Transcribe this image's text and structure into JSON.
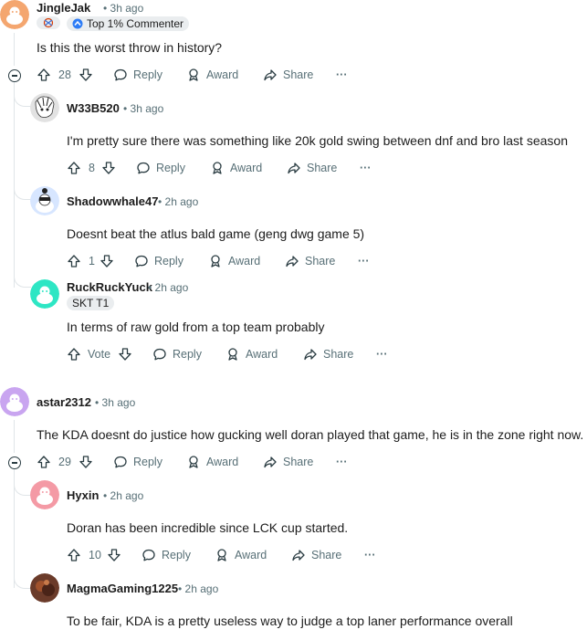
{
  "comments": [
    {
      "user": "JingleJak",
      "time": "3h ago",
      "badge": "Top 1% Commenter",
      "text": "Is this the worst throw in history?",
      "votes": "28",
      "reply": "Reply",
      "award": "Award",
      "share": "Share",
      "more": "···",
      "avatar_color": "#f4a66f"
    },
    {
      "user": "W33B520",
      "time": "3h ago",
      "text": "I'm pretty sure there was something like 20k gold swing between dnf and bro last season",
      "votes": "8",
      "reply": "Reply",
      "award": "Award",
      "share": "Share",
      "more": "···",
      "avatar_color": "#d9d9d9"
    },
    {
      "user": "Shadowwhale47",
      "time": "2h ago",
      "text": "Doesnt beat the atlus bald game (geng dwg game 5)",
      "votes": "1",
      "reply": "Reply",
      "award": "Award",
      "share": "Share",
      "more": "···",
      "avatar_color": "#cfe1ff"
    },
    {
      "user": "RuckRuckYuck",
      "time": "2h ago",
      "flair": "SKT T1",
      "text": "In terms of raw gold from a top team probably",
      "votes": "Vote",
      "reply": "Reply",
      "award": "Award",
      "share": "Share",
      "more": "···",
      "avatar_color": "#2ee6c4"
    },
    {
      "user": "astar2312",
      "time": "3h ago",
      "text": "The KDA doesnt do justice how gucking well doran played that game, he is in the zone right now.",
      "votes": "29",
      "reply": "Reply",
      "award": "Award",
      "share": "Share",
      "more": "···",
      "avatar_color": "#c9a5f0"
    },
    {
      "user": "Hyxin",
      "time": "2h ago",
      "text": "Doran has been incredible since LCK cup started.",
      "votes": "10",
      "reply": "Reply",
      "award": "Award",
      "share": "Share",
      "more": "···",
      "avatar_color": "#f49aa5"
    },
    {
      "user": "MagmaGaming1225",
      "time": "2h ago",
      "text": "To be fair, KDA is a pretty useless way to judge a top laner performance overall",
      "avatar_color": "#6b3b2a"
    }
  ]
}
